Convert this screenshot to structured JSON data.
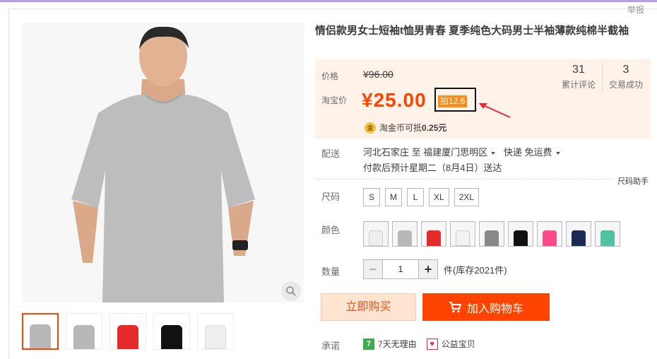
{
  "header": {
    "report_label": "举报"
  },
  "gallery": {
    "main_image_alt": "Gray t-shirt model",
    "thumb_colors": [
      "#b8b8b8",
      "#b8b8b8",
      "#e42a2a",
      "#111111",
      "#eeeeee"
    ]
  },
  "product": {
    "title": "情侣款男女士短袖t恤男青春 夏季纯色大码男士半袖薄款纯棉半截袖"
  },
  "price": {
    "label": "价格",
    "original": "¥96.00",
    "taobao_label": "淘宝价",
    "current": "¥25.00",
    "badge": "拍12.6",
    "reviews_count": "31",
    "reviews_label": "累计评论",
    "deals_count": "3",
    "deals_label": "交易成功",
    "coin_icon": "金",
    "coin_text": "淘金币可抵",
    "coin_amount": "0.25元"
  },
  "delivery": {
    "label": "配送",
    "from": "河北石家庄 至",
    "to": "福建厦门思明区",
    "method": "快递 免运费",
    "eta": "付款后预计星期二（8月4日）送达"
  },
  "size_help": "尺码助手",
  "sizes": {
    "label": "尺码",
    "options": [
      "S",
      "M",
      "L",
      "XL",
      "2XL"
    ]
  },
  "colors": {
    "label": "颜色",
    "swatches": [
      "#eeeeee",
      "#b8b8b8",
      "#e42a2a",
      "#f2f2f2",
      "#888888",
      "#111111",
      "#ff4b8b",
      "#1a2a55",
      "#4fc3a0"
    ]
  },
  "quantity": {
    "label": "数量",
    "minus": "−",
    "value": "1",
    "plus": "+",
    "stock": "件(库存2021件)"
  },
  "actions": {
    "buy_now": "立即购买",
    "add_to_cart": "加入购物车"
  },
  "promise": {
    "label": "承诺",
    "seven_day_icon": "7",
    "seven_day": "7天无理由",
    "charity": "公益宝贝"
  },
  "accent": "#ff4400"
}
